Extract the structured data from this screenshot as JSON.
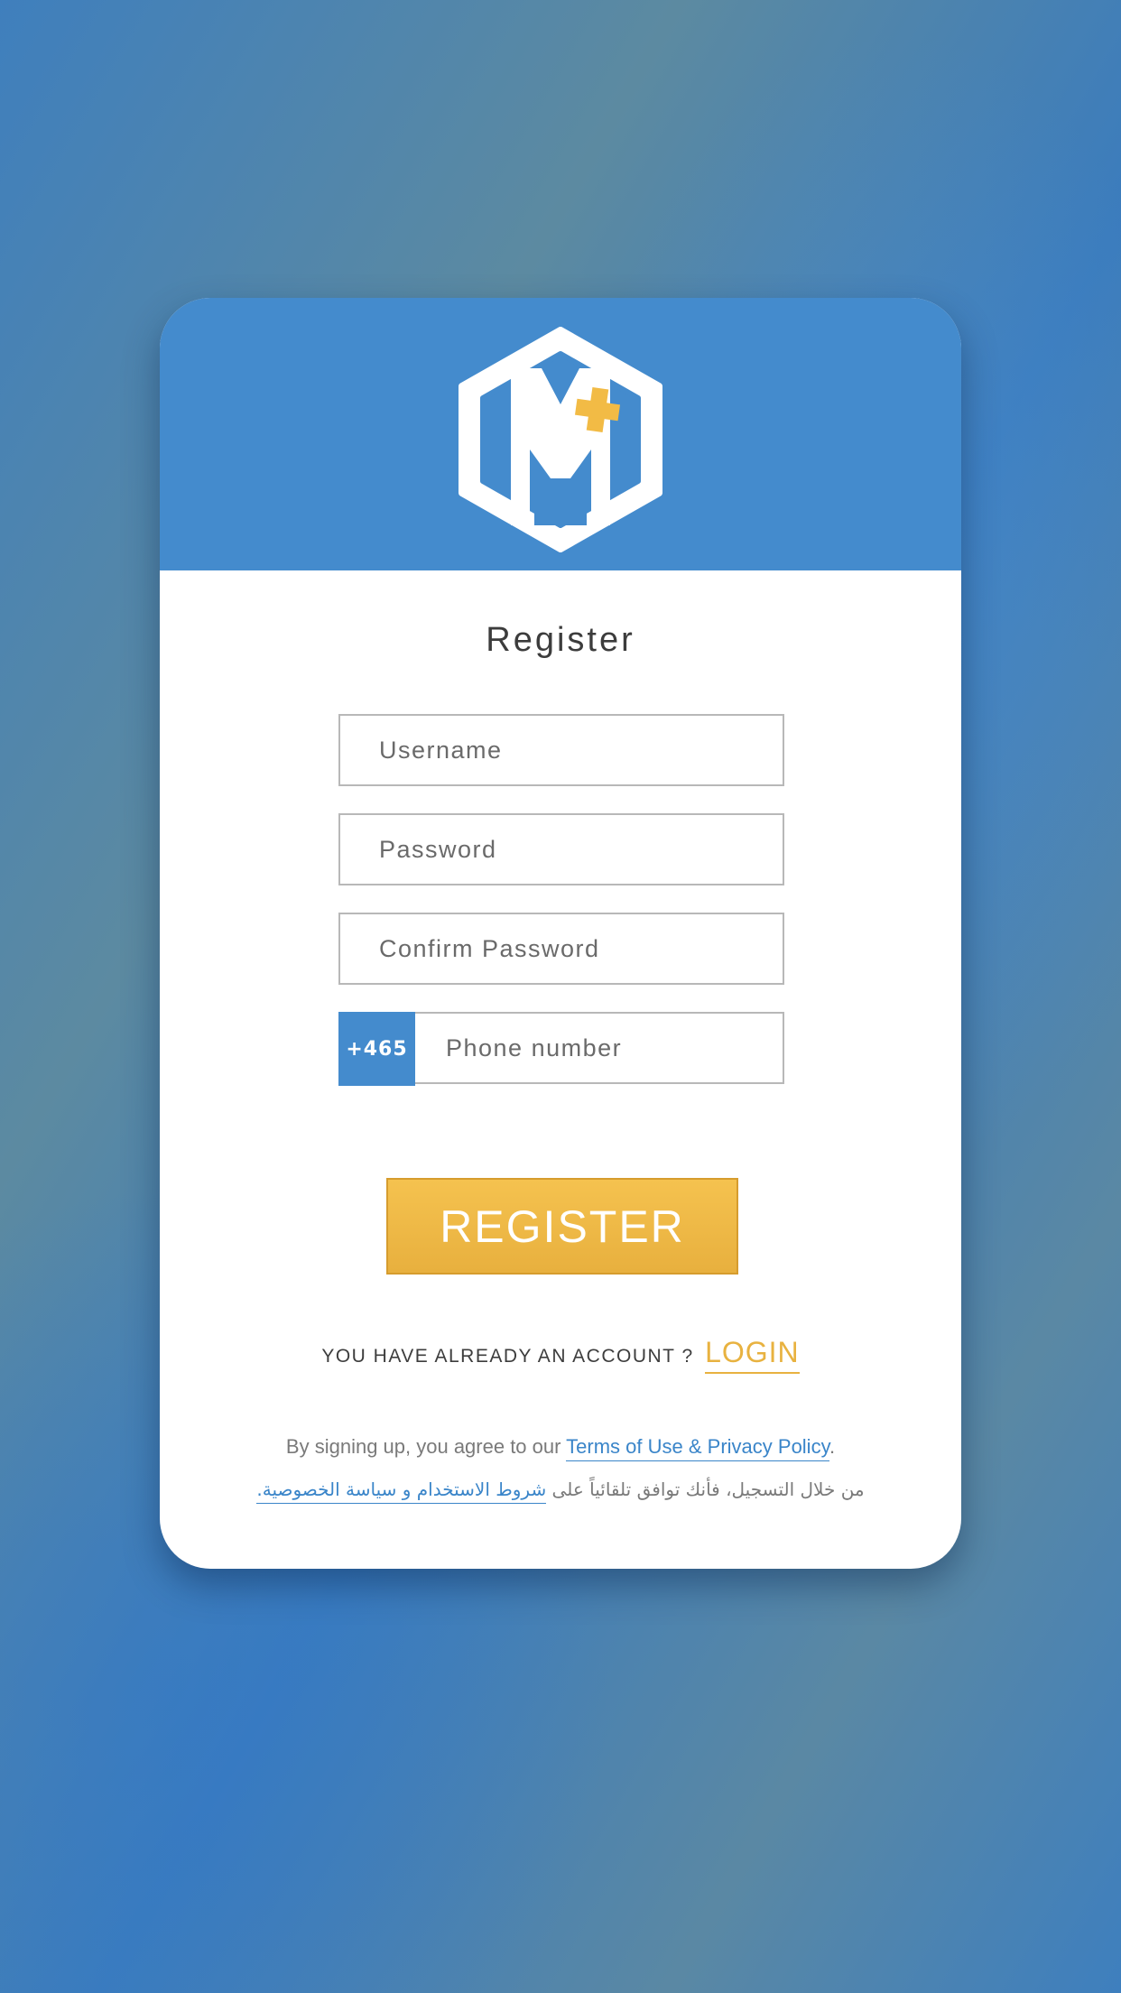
{
  "colors": {
    "brand_blue": "#448bcd",
    "accent_yellow": "#f2bb45",
    "link_blue": "#3a85c9",
    "card_background": "#ffffff"
  },
  "logo": {
    "icon": "hexagon-m-plus-logo",
    "letter": "M",
    "plus_color": "#f2bb45"
  },
  "form": {
    "title": "Register",
    "username_placeholder": "Username",
    "password_placeholder": "Password",
    "confirm_password_placeholder": "Confirm Password",
    "phone_prefix": "+465",
    "phone_placeholder": "Phone number",
    "submit_label": "REGISTER"
  },
  "account": {
    "prompt": "YOU HAVE ALREADY AN ACCOUNT ?",
    "login_label": "LOGIN"
  },
  "terms": {
    "en_prefix": "By signing up, you agree to our ",
    "en_link": "Terms of Use & Privacy Policy",
    "en_suffix": ".",
    "ar_prefix": "من خلال التسجيل، فأنك توافق تلقائياً على ",
    "ar_link": "شروط الاستخدام و سياسة الخصوصية."
  }
}
